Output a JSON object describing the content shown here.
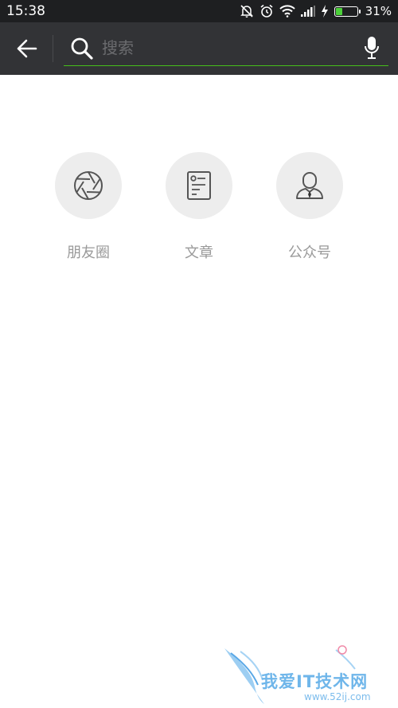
{
  "status_bar": {
    "time": "15:38",
    "battery_percent_text": "31%",
    "battery_level": 0.31,
    "icons": [
      "mute-icon",
      "alarm-icon",
      "wifi-icon",
      "signal-icon",
      "charging-icon",
      "battery-icon"
    ]
  },
  "app_bar": {
    "back_icon": "arrow-left-icon",
    "search_icon": "search-icon",
    "search_placeholder": "搜索",
    "search_value": "",
    "mic_icon": "microphone-icon",
    "accent_color": "#45c01a"
  },
  "categories": [
    {
      "label": "朋友圈",
      "icon": "aperture-icon"
    },
    {
      "label": "文章",
      "icon": "article-icon"
    },
    {
      "label": "公众号",
      "icon": "official-account-icon"
    }
  ],
  "watermark": {
    "text": "我爱IT技术网",
    "url": "www.52ij.com"
  }
}
